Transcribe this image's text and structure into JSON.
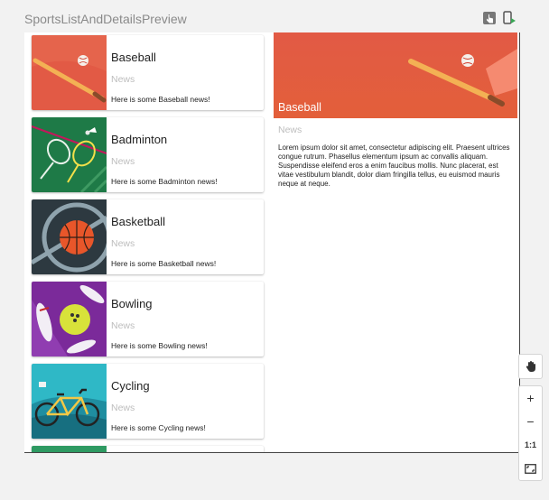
{
  "preview": {
    "title": "SportsListAndDetailsPreview"
  },
  "sports": [
    {
      "title": "Baseball",
      "subtitle": "News",
      "info": "Here is some Baseball news!",
      "color": "#e25a45"
    },
    {
      "title": "Badminton",
      "subtitle": "News",
      "info": "Here is some Badminton news!",
      "color": "#1e7a47"
    },
    {
      "title": "Basketball",
      "subtitle": "News",
      "info": "Here is some Basketball news!",
      "color": "#2d3940"
    },
    {
      "title": "Bowling",
      "subtitle": "News",
      "info": "Here is some Bowling news!",
      "color": "#7b2a9a"
    },
    {
      "title": "Cycling",
      "subtitle": "News",
      "info": "Here is some Cycling news!",
      "color": "#2fb8c6"
    }
  ],
  "detail": {
    "title": "Baseball",
    "subtitle": "News",
    "body": "Lorem ipsum dolor sit amet, consectetur adipiscing elit. Praesent ultrices congue rutrum. Phasellus elementum ipsum ac convallis aliquam. Suspendisse eleifend eros a enim faucibus mollis. Nunc placerat, est vitae vestibulum blandit, dolor diam fringilla tellus, eu euismod mauris neque at neque."
  },
  "toolbar": {
    "pan_icon": "hand-icon",
    "zoom_in": "+",
    "zoom_out": "−",
    "actual_size": "1:1",
    "fit_icon": "fit-screen-icon"
  },
  "colors": {
    "accent_orange": "#e25a45",
    "next_card": "#2e9a62"
  }
}
